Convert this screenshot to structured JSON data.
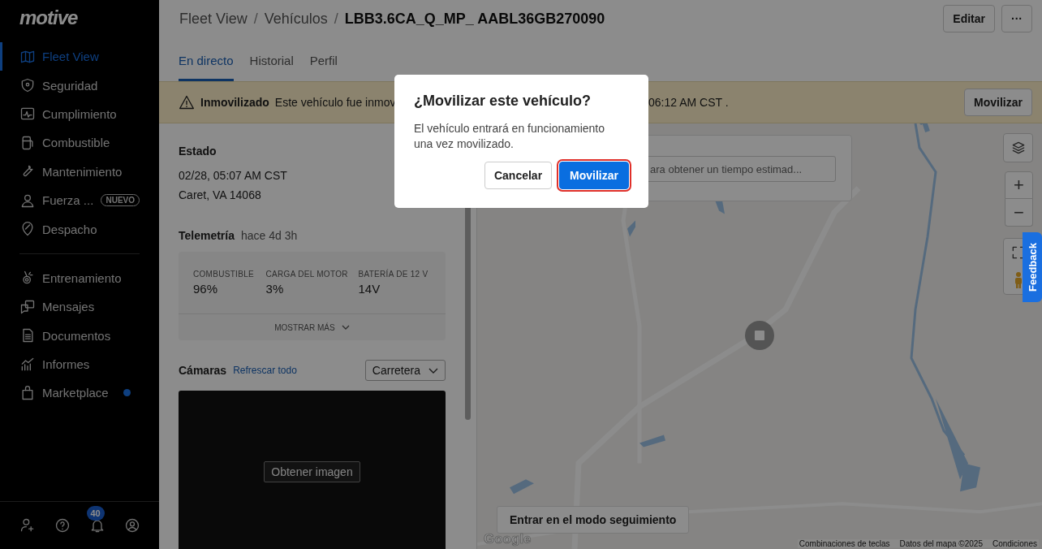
{
  "logo": "motive",
  "sidebar": {
    "groups": [
      {
        "items": [
          {
            "label": "Fleet View",
            "selected": true,
            "dot": false
          },
          {
            "label": "Seguridad",
            "selected": false,
            "dot": false
          },
          {
            "label": "Cumplimiento",
            "selected": false,
            "dot": false
          },
          {
            "label": "Combustible",
            "selected": false,
            "dot": false
          },
          {
            "label": "Mantenimiento",
            "selected": false,
            "dot": false
          },
          {
            "label": "Fuerza ...",
            "selected": false,
            "dot": false,
            "badge": "NUEVO"
          },
          {
            "label": "Despacho",
            "selected": false,
            "dot": false
          }
        ]
      },
      {
        "items": [
          {
            "label": "Entrenamiento",
            "selected": false,
            "dot": false
          },
          {
            "label": "Mensajes",
            "selected": false,
            "dot": false
          },
          {
            "label": "Documentos",
            "selected": false,
            "dot": false
          },
          {
            "label": "Informes",
            "selected": false,
            "dot": false
          },
          {
            "label": "Marketplace",
            "selected": false,
            "dot": true
          }
        ]
      }
    ],
    "notification_count": "40"
  },
  "breadcrumb": [
    "Fleet View",
    "Vehículos",
    "LBB3.6CA_Q_MP_ AABL36GB270090"
  ],
  "breadcrumb_separators": [
    "/",
    "/"
  ],
  "header_buttons": {
    "edit": "Editar",
    "more": "···"
  },
  "tabs": [
    {
      "label": "En directo",
      "selected": true
    },
    {
      "label": "Historial",
      "selected": false
    },
    {
      "label": "Perfil",
      "selected": false
    }
  ],
  "banner": {
    "title": "Inmovilizado",
    "text_before": "Este vehículo fue inmov",
    "text_after": "06:12 AM CST .",
    "button": "Movilizar"
  },
  "status": {
    "heading": "Estado",
    "time": "02/28, 05:07 AM CST",
    "location": "Caret, VA 14068"
  },
  "telemetry": {
    "heading": "Telemetría",
    "age": "hace 4d 3h",
    "metrics": [
      {
        "label": "COMBUSTIBLE",
        "value": "96%"
      },
      {
        "label": "CARGA DEL MOTOR",
        "value": "3%"
      },
      {
        "label": "BATERÍA DE 12 V",
        "value": "14V"
      }
    ],
    "more": "MOSTRAR MÁS"
  },
  "cameras": {
    "heading": "Cámaras",
    "refresh": "Refrescar todo",
    "view": "Carretera",
    "capture": "Obtener imagen"
  },
  "map": {
    "estimate_placeholder": "ara obtener un tiempo estimad...",
    "follow_button": "Entrar en el modo seguimiento",
    "google": "Google",
    "attribution": [
      "Combinaciones de teclas",
      "Datos del mapa ©2025",
      "Condiciones"
    ],
    "zoom_in": "+",
    "zoom_out": "−"
  },
  "feedback": "Feedback",
  "dialog": {
    "title": "¿Movilizar este vehículo?",
    "body": "El vehículo entrará en funcionamiento una vez movilizado.",
    "cancel": "Cancelar",
    "confirm": "Movilizar",
    "confirm_highlighted": true
  }
}
